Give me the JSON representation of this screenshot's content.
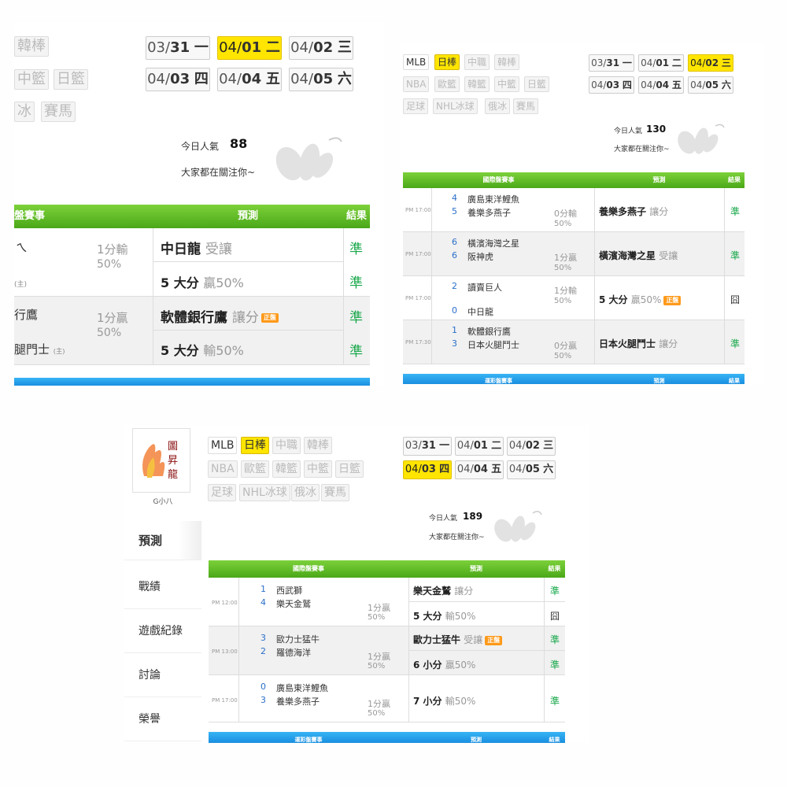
{
  "panel1": {
    "tags": [
      "韓棒",
      "中籃",
      "日籃",
      "冰",
      "賽馬"
    ],
    "dates": [
      {
        "md_prefix": "03/",
        "md": "31",
        "dow": "一"
      },
      {
        "md_prefix": "04/",
        "md": "01",
        "dow": "二"
      },
      {
        "md_prefix": "04/",
        "md": "02",
        "dow": "三"
      },
      {
        "md_prefix": "04/",
        "md": "03",
        "dow": "四"
      },
      {
        "md_prefix": "04/",
        "md": "04",
        "dow": "五"
      },
      {
        "md_prefix": "04/",
        "md": "05",
        "dow": "六"
      }
    ],
    "popularity_label": "今日人氣",
    "popularity_value": "88",
    "popularity_sub": "大家都在關注你~",
    "header": {
      "event": "盤賽事",
      "prediction": "預測",
      "result": "結果"
    },
    "rows": [
      {
        "team_top": "ㄟ",
        "team_bottom": "(主)",
        "line": "1分輸",
        "pct": "50%",
        "p1": "中日龍",
        "p1_sub": "受讓",
        "r1": "準",
        "p2": "5 大分",
        "p2_sub": "贏50%",
        "r2": "準"
      },
      {
        "team_top": "行鷹",
        "team_bottom": "腿門士",
        "host": "(主)",
        "line": "1分贏",
        "pct": "50%",
        "p1": "軟體銀行鷹",
        "p1_sub": "讓分",
        "badge": "正盤",
        "r1": "準",
        "p2": "5 大分",
        "p2_sub": "輸50%",
        "r2": "準"
      }
    ]
  },
  "panel2": {
    "tags": [
      "MLB",
      "日棒",
      "中職",
      "韓棒",
      "NBA",
      "歐籃",
      "韓籃",
      "中籃",
      "日籃",
      "足球",
      "NHL冰球",
      "俄冰",
      "賽馬"
    ],
    "dates": [
      {
        "md_prefix": "03/",
        "md": "31",
        "dow": "一"
      },
      {
        "md_prefix": "04/",
        "md": "01",
        "dow": "二"
      },
      {
        "md_prefix": "04/",
        "md": "02",
        "dow": "三"
      },
      {
        "md_prefix": "04/",
        "md": "03",
        "dow": "四"
      },
      {
        "md_prefix": "04/",
        "md": "04",
        "dow": "五"
      },
      {
        "md_prefix": "04/",
        "md": "05",
        "dow": "六"
      }
    ],
    "popularity_label": "今日人氣",
    "popularity_value": "130",
    "popularity_sub": "大家都在關注你~",
    "header": {
      "event": "國際盤賽事",
      "prediction": "預測",
      "result": "結果"
    },
    "blue_header": {
      "event": "運彩盤賽事",
      "prediction": "預測",
      "result": "結果"
    },
    "rows": [
      {
        "time": "PM 17:00",
        "s1": "4",
        "team1": "廣島東洋鯉魚",
        "s2": "5",
        "team2": "養樂多燕子",
        "line": "0分輸",
        "pct": "50%",
        "pred": "養樂多燕子",
        "pred_sub": "讓分",
        "res": "準"
      },
      {
        "time": "PM 17:00",
        "s1": "6",
        "team1": "橫濱海灣之星",
        "s2": "6",
        "team2": "阪神虎",
        "line": "1分贏",
        "pct": "50%",
        "pred": "橫濱海灣之星",
        "pred_sub": "受讓",
        "res": "準"
      },
      {
        "time": "PM 17:00",
        "s1": "2",
        "team1": "讀賣巨人",
        "s2": "0",
        "team2": "中日龍",
        "line": "1分輸",
        "pct": "50%",
        "pred": "5 大分",
        "pred_sub": "贏50%",
        "badge": "正盤",
        "res": "囧"
      },
      {
        "time": "PM 17:30",
        "s1": "1",
        "team1": "軟體銀行鷹",
        "s2": "3",
        "team2": "日本火腿鬥士",
        "line": "0分贏",
        "pct": "50%",
        "pred": "日本火腿鬥士",
        "pred_sub": "讓分",
        "res": "準"
      }
    ]
  },
  "panel3": {
    "avatar_name": "G小八",
    "sidebar": [
      "預測",
      "戰績",
      "遊戲紀錄",
      "討論",
      "榮譽"
    ],
    "tags": [
      "MLB",
      "日棒",
      "中職",
      "韓棒",
      "NBA",
      "歐籃",
      "韓籃",
      "中籃",
      "日籃",
      "足球",
      "NHL冰球",
      "俄冰",
      "賽馬"
    ],
    "dates": [
      {
        "md_prefix": "03/",
        "md": "31",
        "dow": "一"
      },
      {
        "md_prefix": "04/",
        "md": "01",
        "dow": "二"
      },
      {
        "md_prefix": "04/",
        "md": "02",
        "dow": "三"
      },
      {
        "md_prefix": "04/",
        "md": "03",
        "dow": "四"
      },
      {
        "md_prefix": "04/",
        "md": "04",
        "dow": "五"
      },
      {
        "md_prefix": "04/",
        "md": "05",
        "dow": "六"
      }
    ],
    "popularity_label": "今日人氣",
    "popularity_value": "189",
    "popularity_sub": "大家都在關注你~",
    "header": {
      "event": "國際盤賽事",
      "prediction": "預測",
      "result": "結果"
    },
    "blue_header": {
      "event": "運彩盤賽事",
      "prediction": "預測",
      "result": "結果"
    },
    "rows": [
      {
        "time": "PM 12:00",
        "s1": "1",
        "team1": "西武獅",
        "s2": "4",
        "team2": "樂天金鷲",
        "line": "1分贏",
        "pct": "50%",
        "p1": "樂天金鷲",
        "p1_sub": "讓分",
        "r1": "準",
        "p2": "5 大分",
        "p2_sub": "輸50%",
        "r2": "囧"
      },
      {
        "time": "PM 13:00",
        "s1": "3",
        "team1": "歐力士猛牛",
        "s2": "2",
        "team2": "羅德海洋",
        "line": "1分贏",
        "pct": "50%",
        "p1": "歐力士猛牛",
        "p1_sub": "受讓",
        "badge": "正盤",
        "r1": "準",
        "p2": "6 小分",
        "p2_sub": "贏50%",
        "r2": "準"
      },
      {
        "time": "PM 17:00",
        "s1": "0",
        "team1": "廣島東洋鯉魚",
        "s2": "3",
        "team2": "養樂多燕子",
        "line": "1分贏",
        "pct": "50%",
        "p1": "7 小分",
        "p1_sub": "輸50%",
        "r1": "準"
      }
    ]
  }
}
